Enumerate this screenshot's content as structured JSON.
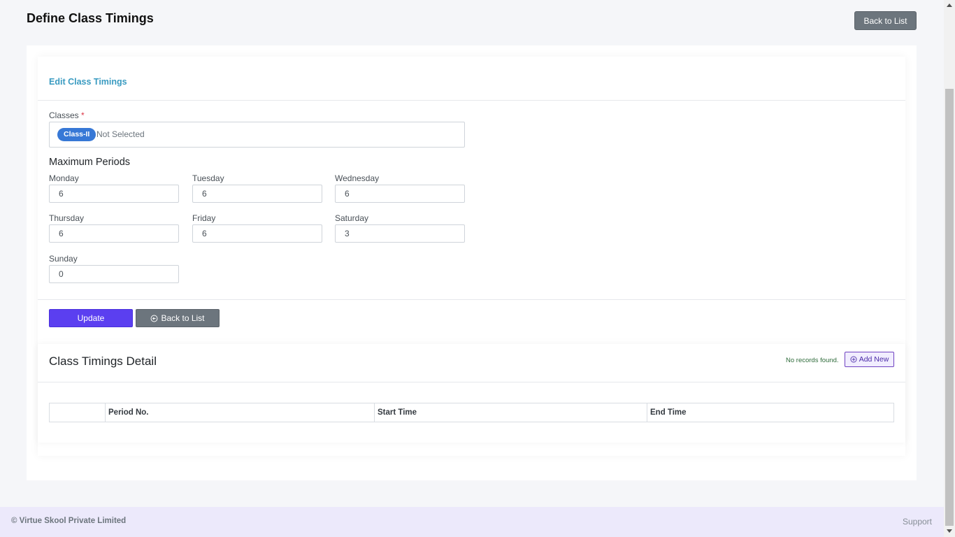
{
  "page": {
    "title": "Define Class Timings",
    "back_button": "Back to List"
  },
  "form": {
    "header": "Edit Class Timings",
    "classes_label": "Classes",
    "required_mark": "*",
    "selected_chip": "Class-II",
    "not_selected": "Not Selected",
    "max_periods_title": "Maximum Periods",
    "days": [
      {
        "label": "Monday",
        "value": "6"
      },
      {
        "label": "Tuesday",
        "value": "6"
      },
      {
        "label": "Wednesday",
        "value": "6"
      },
      {
        "label": "Thursday",
        "value": "6"
      },
      {
        "label": "Friday",
        "value": "6"
      },
      {
        "label": "Saturday",
        "value": "3"
      },
      {
        "label": "Sunday",
        "value": "0"
      }
    ],
    "update_button": "Update",
    "back_button": "Back to List",
    "back_icon": "circle-arrow-left-icon"
  },
  "detail": {
    "title": "Class Timings Detail",
    "no_records": "No records found.",
    "add_button": "Add New",
    "add_icon": "circle-plus-icon",
    "columns": [
      "",
      "Period No.",
      "Start Time",
      "End Time"
    ]
  },
  "footer": {
    "copyright": "© Virtue Skool Private Limited",
    "support": "Support"
  },
  "colors": {
    "accent_blue": "#3a9bc1",
    "update_purple": "#5b3ff0",
    "chip_blue": "#3778d6",
    "secondary_gray": "#6c757d"
  }
}
